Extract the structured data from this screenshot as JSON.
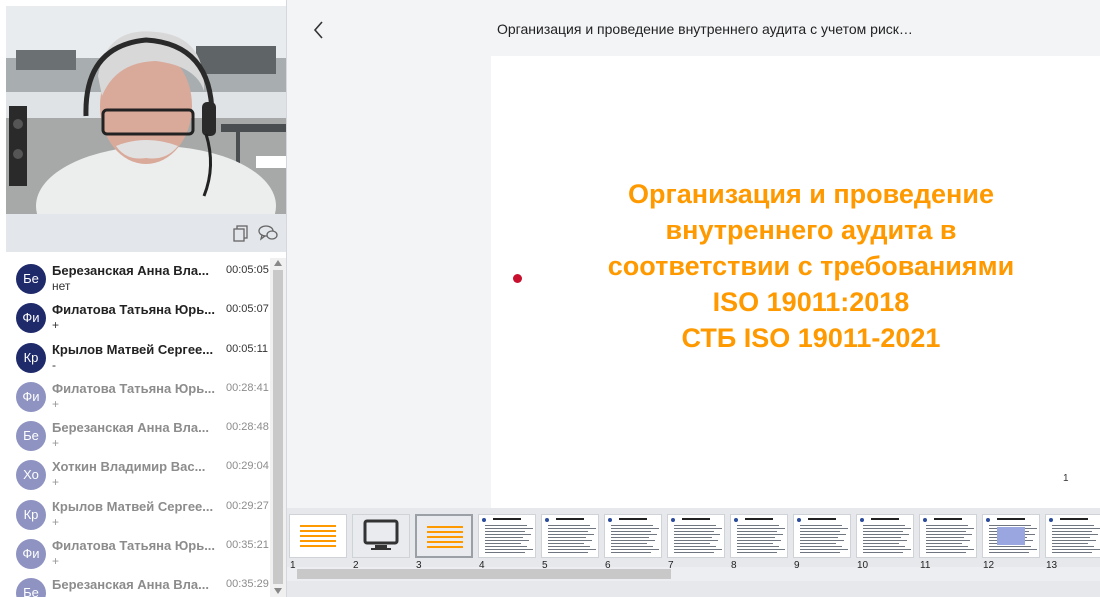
{
  "presentation": {
    "title": "Организация и проведение внутреннего аудита с учетом риск…"
  },
  "slide": {
    "title_lines": [
      "Организация и проведение",
      "внутреннего аудита в",
      "соответствии с требованиями",
      "ISO 19011:2018",
      "СТБ ISO 19011-2021"
    ],
    "page_number": "1",
    "title_color": "#ff9900"
  },
  "toolbar": {
    "copy_icon": "copy-icon",
    "chat_icon": "chat-icon"
  },
  "chat": {
    "messages": [
      {
        "initials": "Бе",
        "name": "Березанская Анна Вла...",
        "time": "00:05:05",
        "text": "нет",
        "read": false
      },
      {
        "initials": "Фи",
        "name": "Филатова Татьяна Юрь...",
        "time": "00:05:07",
        "text": "+",
        "read": false
      },
      {
        "initials": "Кр",
        "name": "Крылов Матвей Сергее...",
        "time": "00:05:11",
        "text": "-",
        "read": false
      },
      {
        "initials": "Фи",
        "name": "Филатова Татьяна Юрь...",
        "time": "00:28:41",
        "text": "+",
        "read": true
      },
      {
        "initials": "Бе",
        "name": "Березанская Анна Вла...",
        "time": "00:28:48",
        "text": "+",
        "read": true
      },
      {
        "initials": "Хо",
        "name": "Хоткин Владимир Вас...",
        "time": "00:29:04",
        "text": "+",
        "read": true
      },
      {
        "initials": "Кр",
        "name": "Крылов Матвей Сергее...",
        "time": "00:29:27",
        "text": "+",
        "read": true
      },
      {
        "initials": "Фи",
        "name": "Филатова Татьяна Юрь...",
        "time": "00:35:21",
        "text": "+",
        "read": true
      },
      {
        "initials": "Бе",
        "name": "Березанская Анна Вла...",
        "time": "00:35:29",
        "text": "+",
        "read": true
      }
    ],
    "avatar_color_unread": "#1f2a6b",
    "avatar_color_read": "#8e93c2"
  },
  "thumbnails": {
    "numbers": [
      "1",
      "2",
      "3",
      "4",
      "5",
      "6",
      "7",
      "8",
      "9",
      "10",
      "11",
      "12",
      "13"
    ],
    "selected": "3",
    "screen_share_slide": "2"
  }
}
